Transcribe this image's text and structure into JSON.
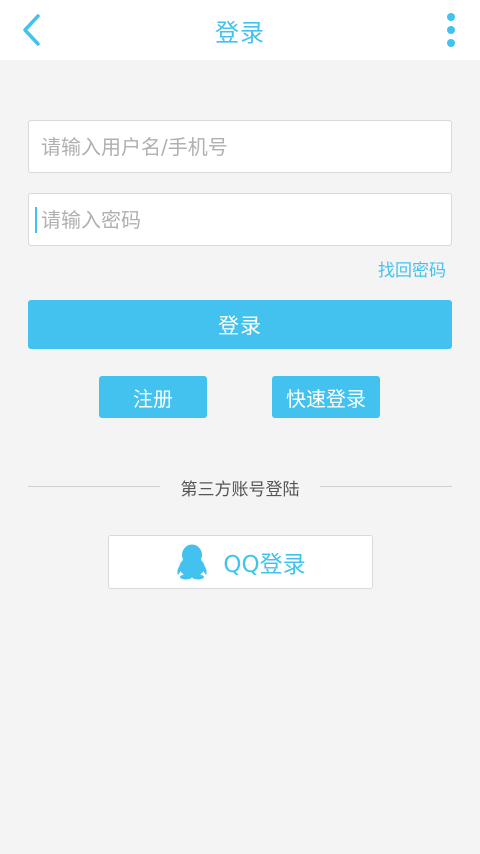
{
  "header": {
    "title": "登录",
    "back_icon": "chevron-left-icon",
    "more_icon": "more-vertical-icon"
  },
  "form": {
    "username": {
      "placeholder": "请输入用户名/手机号",
      "value": ""
    },
    "password": {
      "placeholder": "请输入密码",
      "value": ""
    },
    "forgot_label": "找回密码",
    "login_label": "登录",
    "register_label": "注册",
    "quick_login_label": "快速登录"
  },
  "third_party": {
    "divider_label": "第三方账号登陆",
    "qq_label": "QQ登录",
    "qq_icon": "qq-penguin-icon"
  },
  "colors": {
    "accent": "#43c2ef",
    "background": "#f4f4f4",
    "surface": "#ffffff"
  }
}
